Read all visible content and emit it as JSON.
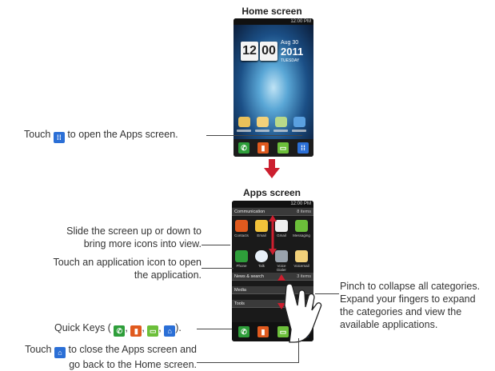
{
  "titles": {
    "home": "Home screen",
    "apps": "Apps screen"
  },
  "phone_home": {
    "status_time": "12:00 PM",
    "clock_hour": "12",
    "clock_min": "00",
    "date_day": "Aug 30",
    "date_year": "2011",
    "date_weekday": "TUESDAY"
  },
  "phone_apps": {
    "status_time": "12:00 PM",
    "categories": [
      {
        "name": "Communication",
        "count": "8 items"
      },
      {
        "name": "News & search",
        "count": "3 items"
      },
      {
        "name": "Media",
        "count": ""
      },
      {
        "name": "Tools",
        "count": ""
      }
    ],
    "apps_row1": [
      "Contacts",
      "Email",
      "Gmail",
      "Messaging"
    ],
    "apps_row2": [
      "Phone",
      "Talk",
      "Voice Dialer",
      "Voicemail"
    ]
  },
  "captions": {
    "touch_apps_pre": "Touch",
    "touch_apps_post": "to open the Apps screen.",
    "slide_1": "Slide the screen up or down to",
    "slide_2": "bring more icons into view.",
    "touch_icon_1": "Touch an application icon to open",
    "touch_icon_2": "the application.",
    "pinch_1": "Pinch to collapse all categories.",
    "pinch_2": "Expand your fingers to expand",
    "pinch_3": "the categories and view the",
    "pinch_4": "available applications.",
    "quick_keys": "Quick Keys (",
    "quick_keys_sep": ",",
    "quick_keys_end": ").",
    "touch_home_pre": "Touch",
    "touch_home_post": "to close the Apps screen and",
    "touch_home_2": "go back to the Home screen."
  },
  "colors": {
    "arrow": "#cc1f2f",
    "phone_key": "#2e9e3a",
    "contacts_key": "#e05a1e",
    "message_key": "#6cbf3a",
    "apps_key": "#2b6fd6"
  }
}
